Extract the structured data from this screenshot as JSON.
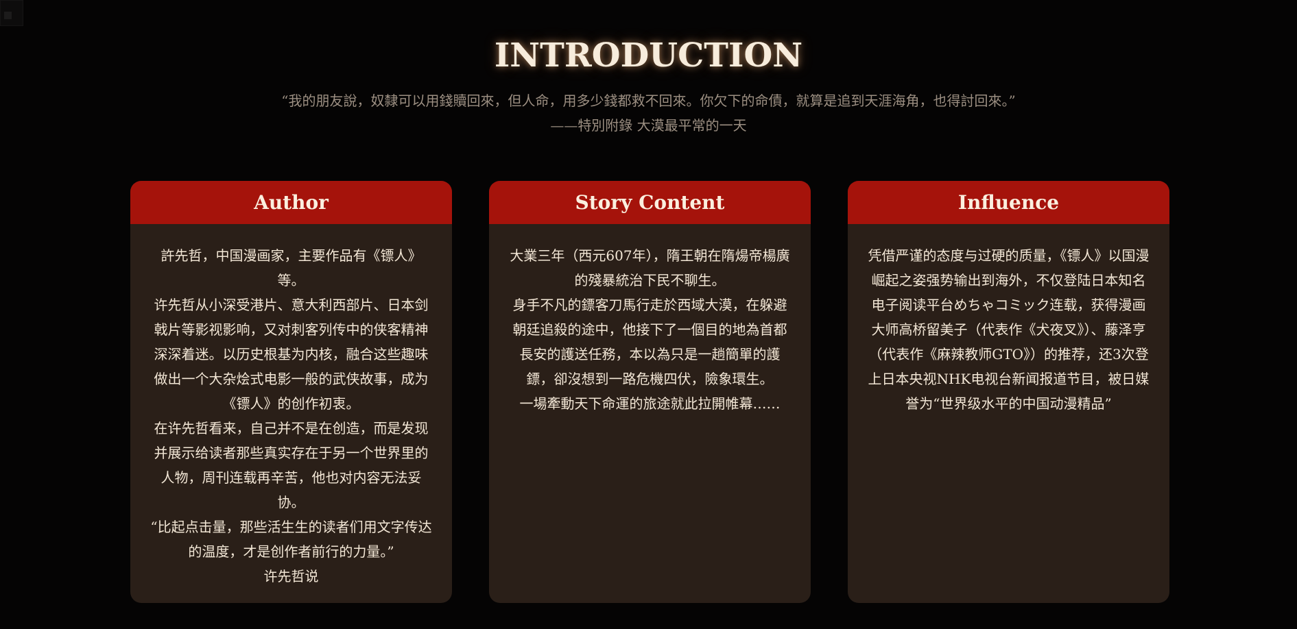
{
  "header": {
    "title": "INTRODUCTION",
    "quote": "“我的朋友說，奴隸可以用錢贖回來，但人命，用多少錢都救不回來。你欠下的命債，就算是追到天涯海角，也得討回來。”",
    "quote_source": "——特別附錄 大漠最平常的一天"
  },
  "cards": [
    {
      "title": "Author",
      "paragraphs": [
        "許先哲，中国漫画家，主要作品有《镖人》等。",
        "许先哲从小深受港片、意大利西部片、日本剑戟片等影视影响，又对刺客列传中的侠客精神深深着迷。以历史根基为内核，融合这些趣味做出一个大杂烩式电影一般的武侠故事，成为《镖人》的创作初衷。",
        "在许先哲看来，自己并不是在创造，而是发现并展示给读者那些真实存在于另一个世界里的人物，周刊连载再辛苦，他也对内容无法妥协。",
        "“比起点击量，那些活生生的读者们用文字传达的温度，才是创作者前行的力量。”",
        "许先哲说"
      ]
    },
    {
      "title": "Story Content",
      "paragraphs": [
        "大業三年（西元607年），隋王朝在隋煬帝楊廣的殘暴統治下民不聊生。",
        "身手不凡的鏢客刀馬行走於西域大漠，在躲避朝廷追殺的途中，他接下了一個目的地為首都長安的護送任務，本以為只是一趟簡單的護鏢，卻沒想到一路危機四伏，險象環生。",
        "一場牽動天下命運的旅途就此拉開帷幕……"
      ]
    },
    {
      "title": "Influence",
      "paragraphs": [
        "凭借严谨的态度与过硬的质量，《镖人》以国漫崛起之姿强势输出到海外，不仅登陆日本知名电子阅读平台めちゃコミック连载，获得漫画大师高桥留美子（代表作《犬夜叉》）、藤泽亨（代表作《麻辣教师GTO》）的推荐，还3次登上日本央视NHK电视台新闻报道节目，被日媒誉为“世界级水平的中国动漫精品”"
      ]
    }
  ]
}
